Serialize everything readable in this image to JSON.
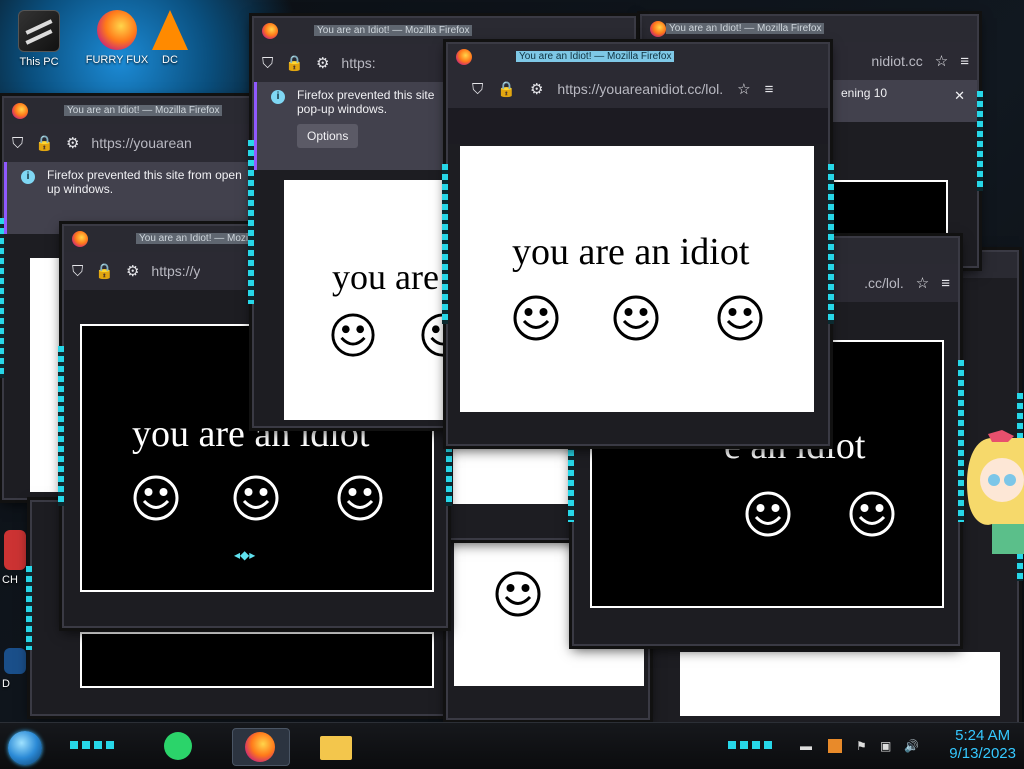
{
  "desktop": {
    "icons": [
      {
        "label": "This PC",
        "icon": "computer-icon"
      },
      {
        "label": "FURRY FUX",
        "icon": "firefox-icon"
      },
      {
        "label": "DC",
        "icon": "vlc-icon"
      },
      {
        "label": "CH",
        "icon": "app-icon"
      },
      {
        "label": "D",
        "icon": "app-icon"
      }
    ]
  },
  "windows": {
    "title": "You are an Idiot! — Mozilla Firefox",
    "url_long": "https://youareanidiot.cc/lol.",
    "url_short1": "https://youarean",
    "url_short2": "https://y",
    "url_tail": "nidiot.cc",
    "url_tail2": ".cc/lol.",
    "url_mid": "https:",
    "notice_text": "Firefox prevented this site from opening 10 pop-up windows.",
    "notice_line1": "Firefox prevented this site",
    "notice_line2": "pop-up windows.",
    "notice_back_line1": "Firefox prevented this site from open",
    "notice_back_line2": "up windows.",
    "notice_tail": "ening 10",
    "options_label": "Options",
    "close_glyph": "✕",
    "message": "you are an idiot",
    "message_partial": "you are",
    "message_tail": "e an idiot",
    "info_glyph": "i"
  },
  "taskbar": {
    "time": "5:24 AM",
    "date": "9/13/2023",
    "apps": [
      "start-orb",
      "notes-app",
      "firefox",
      "file-explorer"
    ]
  },
  "colors": {
    "accent_cyan": "#27d7e8",
    "clock": "#35c8ff",
    "firefox_toolbar": "#2b2a33"
  }
}
